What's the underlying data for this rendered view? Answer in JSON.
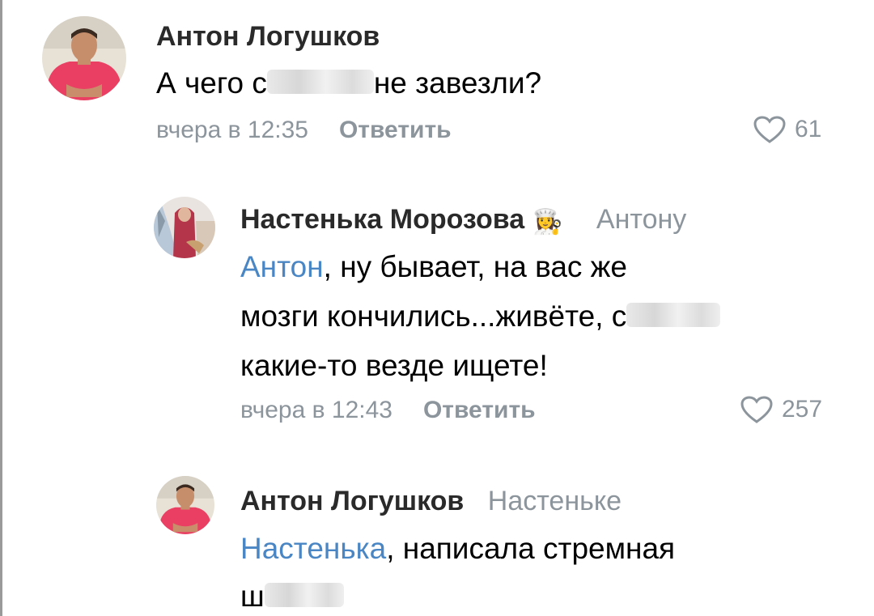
{
  "comments": [
    {
      "author": "Антон Логушков",
      "reply_to": "",
      "mention": "",
      "text_before": "А чего с",
      "text_after": "не завезли?",
      "time": "вчера в 12:35",
      "reply_label": "Ответить",
      "likes": "61"
    },
    {
      "author": "Настенька Морозова",
      "reply_to": "Антону",
      "mention": "Антон",
      "line1": ", ну бывает, на вас же",
      "line2": "мозги кончились...живёте, с",
      "line3": "какие-то везде ищете!",
      "time": "вчера в 12:43",
      "reply_label": "Ответить",
      "likes": "257"
    },
    {
      "author": "Антон Логушков",
      "reply_to": "Настеньке",
      "mention": "Настенька",
      "line1": ", написала стремная",
      "line2": "ш",
      "time": "",
      "reply_label": "",
      "likes": ""
    }
  ],
  "colors": {
    "link": "#4a86c4",
    "meta": "#8c949c",
    "name": "#2a2a2a"
  },
  "icons": {
    "like": "heart-icon",
    "badge": "chef-emoji"
  }
}
